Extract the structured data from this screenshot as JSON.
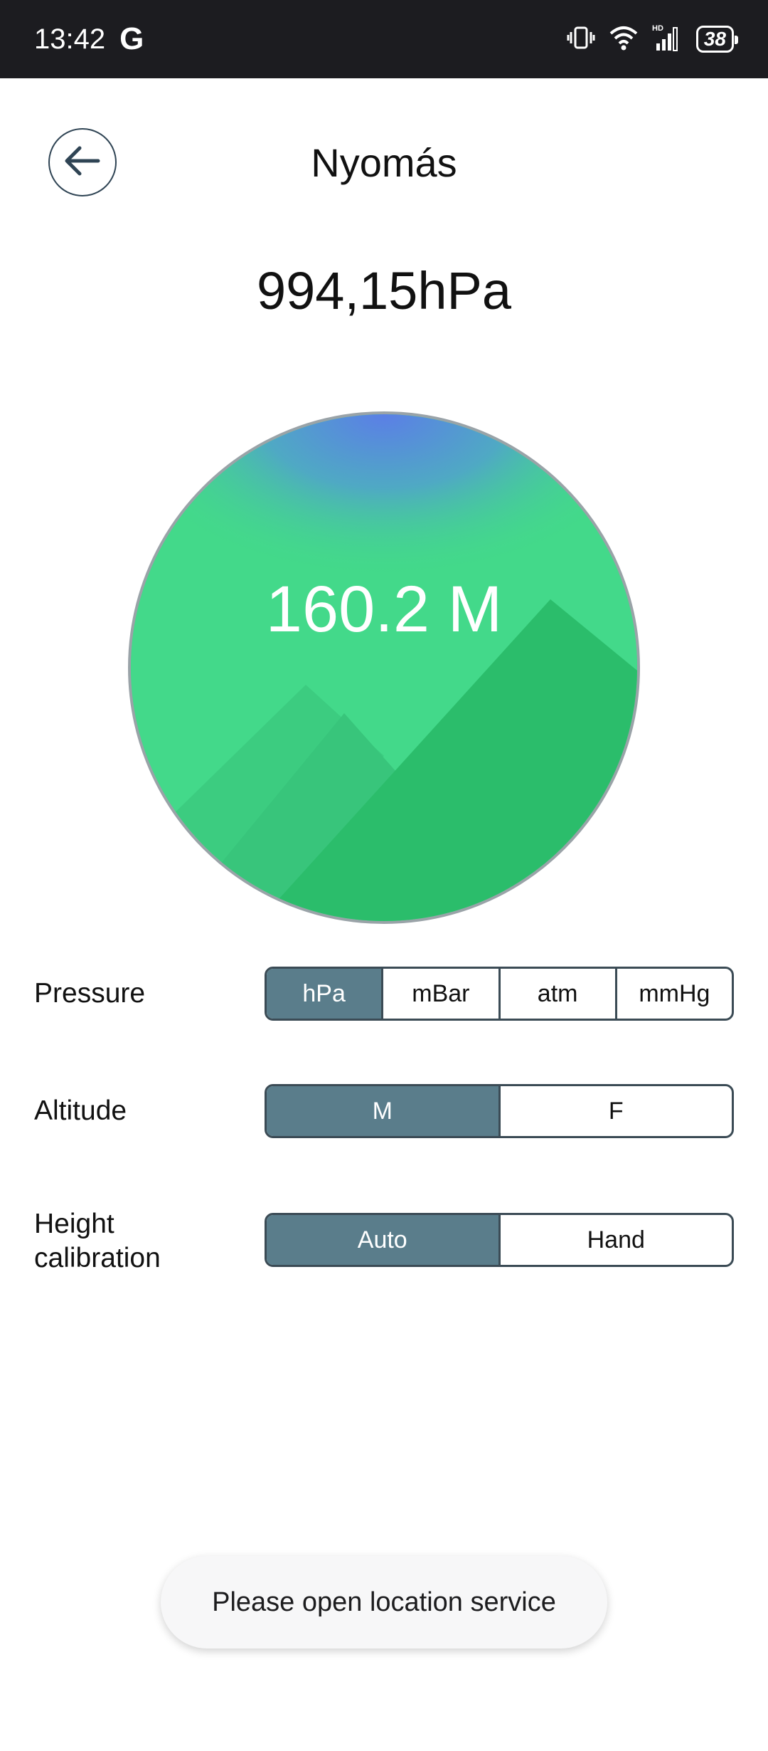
{
  "status_bar": {
    "time": "13:42",
    "google_icon": "G",
    "battery_level": "38",
    "icons": [
      "vibrate-icon",
      "wifi-icon",
      "signal-hd-icon",
      "battery-icon"
    ]
  },
  "header": {
    "title": "Nyomás",
    "back_icon": "arrow-left-icon"
  },
  "reading": {
    "pressure": "994,15hPa"
  },
  "gauge": {
    "altitude": "160.2 M",
    "colors": {
      "top": "#5b86e0",
      "main": "#43d98a",
      "mountain_dark": "#2bbd6b"
    }
  },
  "settings": {
    "pressure": {
      "label": "Pressure",
      "options": [
        "hPa",
        "mBar",
        "atm",
        "mmHg"
      ],
      "selected": "hPa"
    },
    "altitude": {
      "label": "Altitude",
      "options": [
        "M",
        "F"
      ],
      "selected": "M"
    },
    "height_calibration": {
      "label": "Height calibration",
      "options": [
        "Auto",
        "Hand"
      ],
      "selected": "Auto"
    }
  },
  "toast": {
    "message": "Please open location service"
  },
  "colors": {
    "accent": "#5a7d8b",
    "border": "#3b4b55",
    "status_bar_bg": "#1c1c20"
  }
}
